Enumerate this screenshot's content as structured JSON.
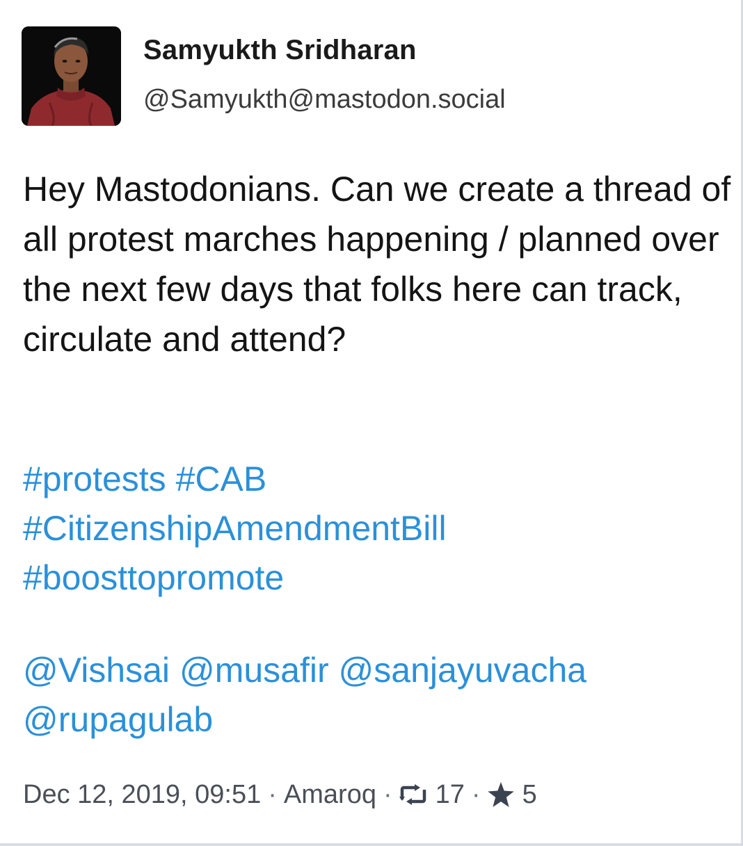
{
  "account": {
    "display_name": "Samyukth Sridharan",
    "handle": "@Samyukth@mastodon.social",
    "avatar_icon": "profile-photo"
  },
  "status": {
    "paragraph": "Hey Mastodonians. Can we create a thread of all protest marches happening / planned over the next few days that folks here can track, circulate and attend?",
    "hashtags": [
      "#protests",
      "#CAB",
      "#CitizenshipAmendmentBill",
      "#boosttopromote"
    ],
    "mentions": [
      "@Vishsai",
      "@musafir",
      "@sanjayuvacha",
      "@rupagulab"
    ]
  },
  "meta": {
    "timestamp": "Dec 12, 2019, 09:51",
    "separator": "·",
    "client": "Amaroq",
    "boost_icon": "boost-icon",
    "boost_count": "17",
    "favourite_icon": "star-icon",
    "favourite_count": "5"
  },
  "colors": {
    "link": "#2b90d9",
    "text": "#141414",
    "muted": "#4a4f57"
  }
}
